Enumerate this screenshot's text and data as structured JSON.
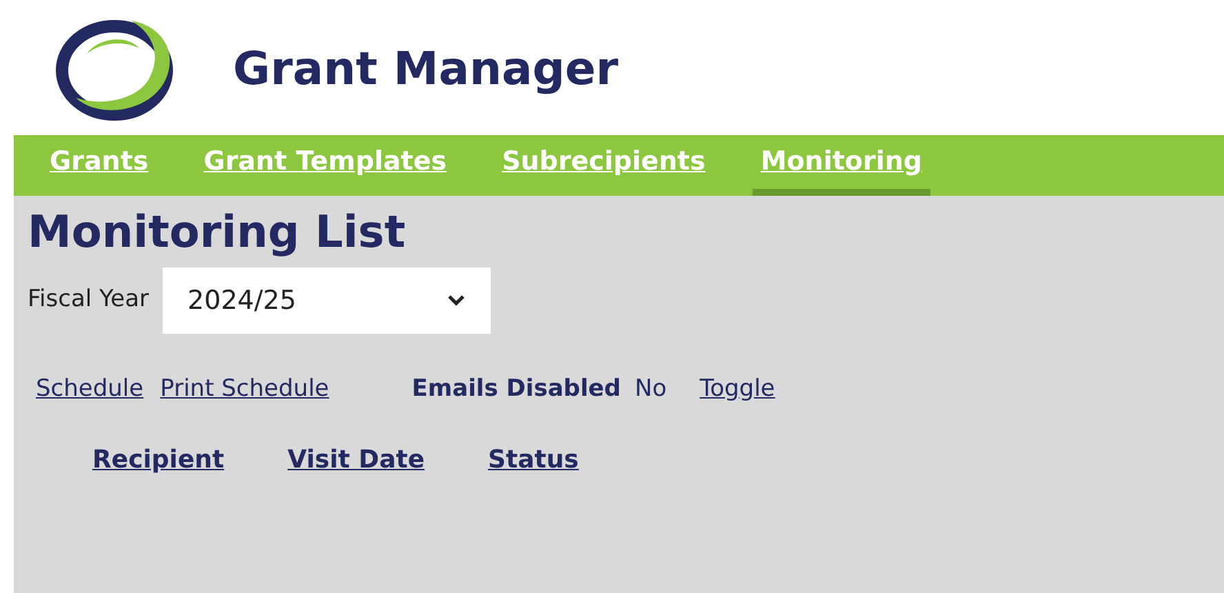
{
  "app": {
    "title": "Grant Manager"
  },
  "nav": [
    {
      "label": "Grants",
      "selected": false
    },
    {
      "label": "Grant Templates",
      "selected": false
    },
    {
      "label": "Subrecipients",
      "selected": false
    },
    {
      "label": "Monitoring",
      "selected": true
    }
  ],
  "page": {
    "heading": "Monitoring List"
  },
  "filter": {
    "label": "Fiscal Year",
    "value": "2024/25"
  },
  "actions": {
    "links": [
      "Schedule",
      "Print Schedule"
    ],
    "emails_label": "Emails Disabled",
    "emails_value": "No",
    "toggle": "Toggle"
  },
  "table": {
    "columns": [
      "Recipient",
      "Visit Date",
      "Status"
    ]
  }
}
